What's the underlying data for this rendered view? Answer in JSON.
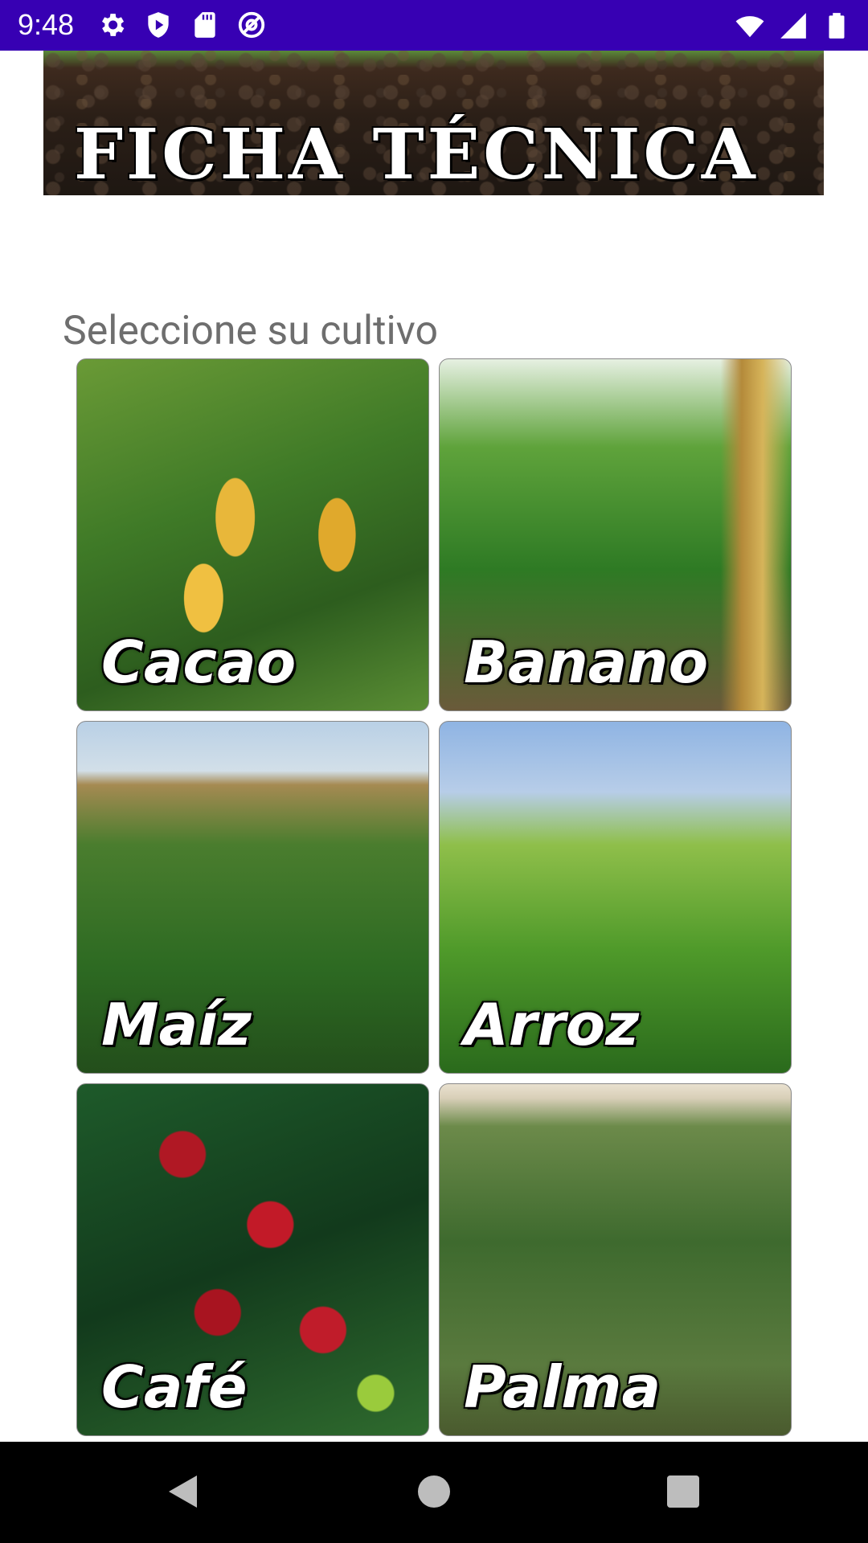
{
  "status_bar": {
    "time": "9:48",
    "left_icons": [
      "gear-icon",
      "play-shield-icon",
      "sd-card-icon",
      "at-sign-icon"
    ],
    "right_icons": [
      "wifi-icon",
      "signal-icon",
      "battery-icon"
    ]
  },
  "banner": {
    "title": "FICHA TÉCNICA"
  },
  "section_label": "Seleccione su cultivo",
  "crops": [
    {
      "label": "Cacao"
    },
    {
      "label": "Banano"
    },
    {
      "label": "Maíz"
    },
    {
      "label": "Arroz"
    },
    {
      "label": "Café"
    },
    {
      "label": "Palma"
    }
  ],
  "nav_bar": {
    "buttons": [
      "back-icon",
      "home-icon",
      "recents-icon"
    ]
  }
}
